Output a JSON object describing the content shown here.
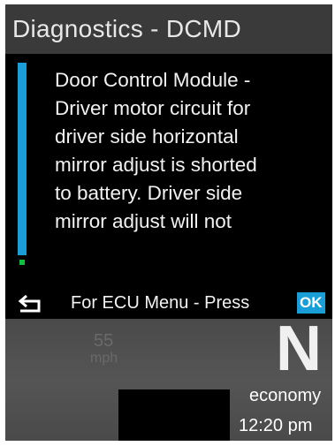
{
  "header": {
    "title": "Diagnostics - DCMD"
  },
  "message": {
    "lines": [
      "Door Control Module -",
      "Driver motor circuit for",
      "driver side horizontal",
      "mirror adjust is shorted",
      "to battery. Driver side",
      "mirror adjust will not"
    ]
  },
  "footer": {
    "back_icon": "back-arrow-icon",
    "prompt": "For ECU Menu - Press",
    "ok_label": "OK"
  },
  "cluster": {
    "speed": "55",
    "speed_unit": "mph",
    "gear": "N",
    "mode": "economy",
    "time": "12:20 pm"
  },
  "colors": {
    "accent": "#1a9ed8",
    "title_bar": "#3a3a3a",
    "scroll_marker": "#0fbf3a"
  }
}
